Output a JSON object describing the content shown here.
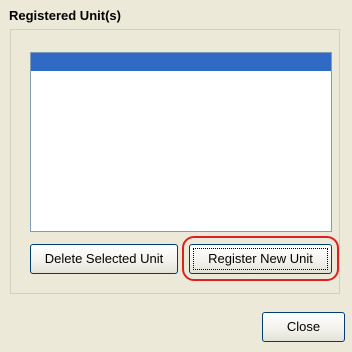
{
  "group": {
    "title": "Registered Unit(s)"
  },
  "list": {
    "items": [
      ""
    ],
    "selected_index": 0
  },
  "buttons": {
    "delete_label": "Delete Selected Unit",
    "register_label": "Register New Unit",
    "close_label": "Close"
  },
  "colors": {
    "selection": "#316ac5",
    "highlight": "#e02020",
    "dialog_bg": "#ece9d8"
  }
}
